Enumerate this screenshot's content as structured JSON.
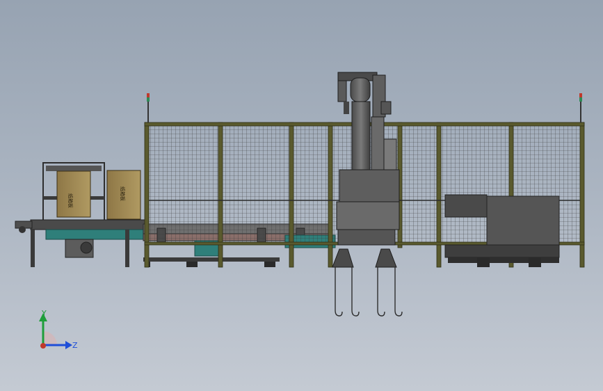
{
  "viewport": {
    "background_top": "#97a3b2",
    "background_bottom": "#c4cad3"
  },
  "colors": {
    "frame": "#5a5a2e",
    "frame_edge": "#2e2e16",
    "mesh": "#3b3b3b",
    "robot_dark": "#3a3a3a",
    "robot_mid": "#6c6c6c",
    "robot_light": "#8d8d8d",
    "carton": "#a08850",
    "teal": "#2f7f7a",
    "beacon_red": "#c0392b",
    "beacon_green": "#2e8b57"
  },
  "cartons": {
    "left_label": "纸箱板",
    "right_label": "纸箱板"
  },
  "triad": {
    "y_label": "Y",
    "z_label": "Z",
    "y_color": "#1e9e3a",
    "z_color": "#1f4fd8",
    "origin_color": "#c0392b"
  }
}
